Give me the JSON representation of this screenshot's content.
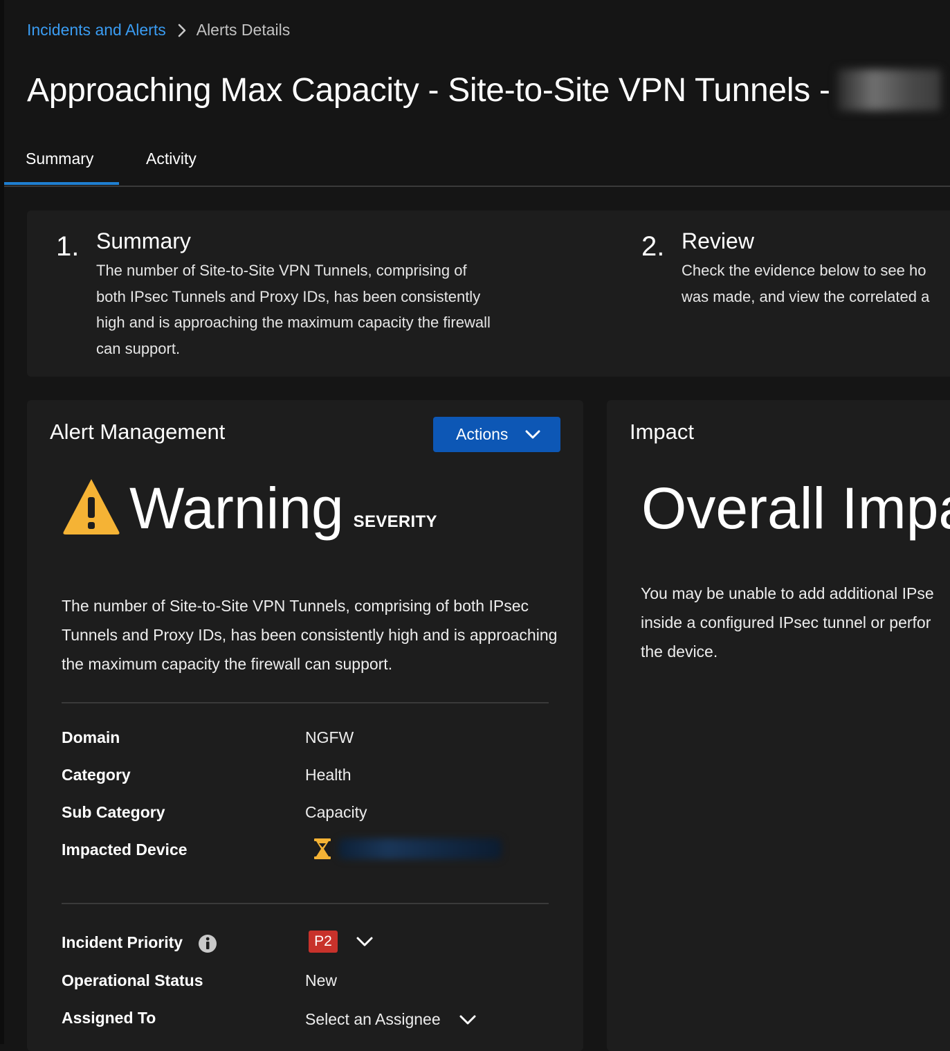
{
  "breadcrumb": {
    "parent": "Incidents and Alerts",
    "current": "Alerts Details"
  },
  "page": {
    "title": "Approaching Max Capacity - Site-to-Site VPN Tunnels -"
  },
  "tabs": [
    {
      "label": "Summary",
      "active": true
    },
    {
      "label": "Activity",
      "active": false
    }
  ],
  "steps": [
    {
      "number": "1.",
      "title": "Summary",
      "lines": [
        "The number of Site-to-Site VPN Tunnels, comprising of",
        "both IPsec Tunnels and Proxy IDs, has been consistently",
        "high and is approaching the maximum capacity the firewall",
        "can support."
      ]
    },
    {
      "number": "2.",
      "title": "Review",
      "lines": [
        "Check the evidence below to see ho",
        "was made, and view the correlated a"
      ]
    }
  ],
  "alert_management": {
    "title": "Alert Management",
    "actions_label": "Actions",
    "severity_word": "Warning",
    "severity_label": "SEVERITY",
    "description_lines": [
      "The number of Site-to-Site VPN Tunnels, comprising of both IPsec",
      "Tunnels and Proxy IDs, has been consistently high and is approaching",
      "the maximum capacity the firewall can support."
    ],
    "fields": [
      {
        "label": "Domain",
        "value": "NGFW"
      },
      {
        "label": "Category",
        "value": "Health"
      },
      {
        "label": "Sub Category",
        "value": "Capacity"
      },
      {
        "label": "Impacted Device",
        "value": ""
      }
    ],
    "incident_priority_label": "Incident Priority",
    "incident_priority_value": "P2",
    "operational_status_label": "Operational Status",
    "operational_status_value": "New",
    "assigned_to_label": "Assigned To",
    "assigned_to_value": "Select an Assignee"
  },
  "impact": {
    "title": "Impact",
    "big_text": "Overall Impa",
    "description_lines": [
      "You may be unable to add additional IPse",
      "inside a configured IPsec tunnel or perfor",
      "the device."
    ]
  },
  "colors": {
    "background": "#151515",
    "card": "#1d1d1d",
    "link": "#3a9cf2",
    "primary_button": "#0d57b5",
    "warning": "#f5b335",
    "priority_badge": "#c8322b",
    "tab_underline": "#1f7fd1"
  },
  "icons": {
    "breadcrumb_separator": "chevron-right-icon",
    "actions_dropdown": "chevron-down-icon",
    "severity": "warning-triangle-icon",
    "impacted_device": "hourglass-icon",
    "priority_info": "info-icon"
  }
}
